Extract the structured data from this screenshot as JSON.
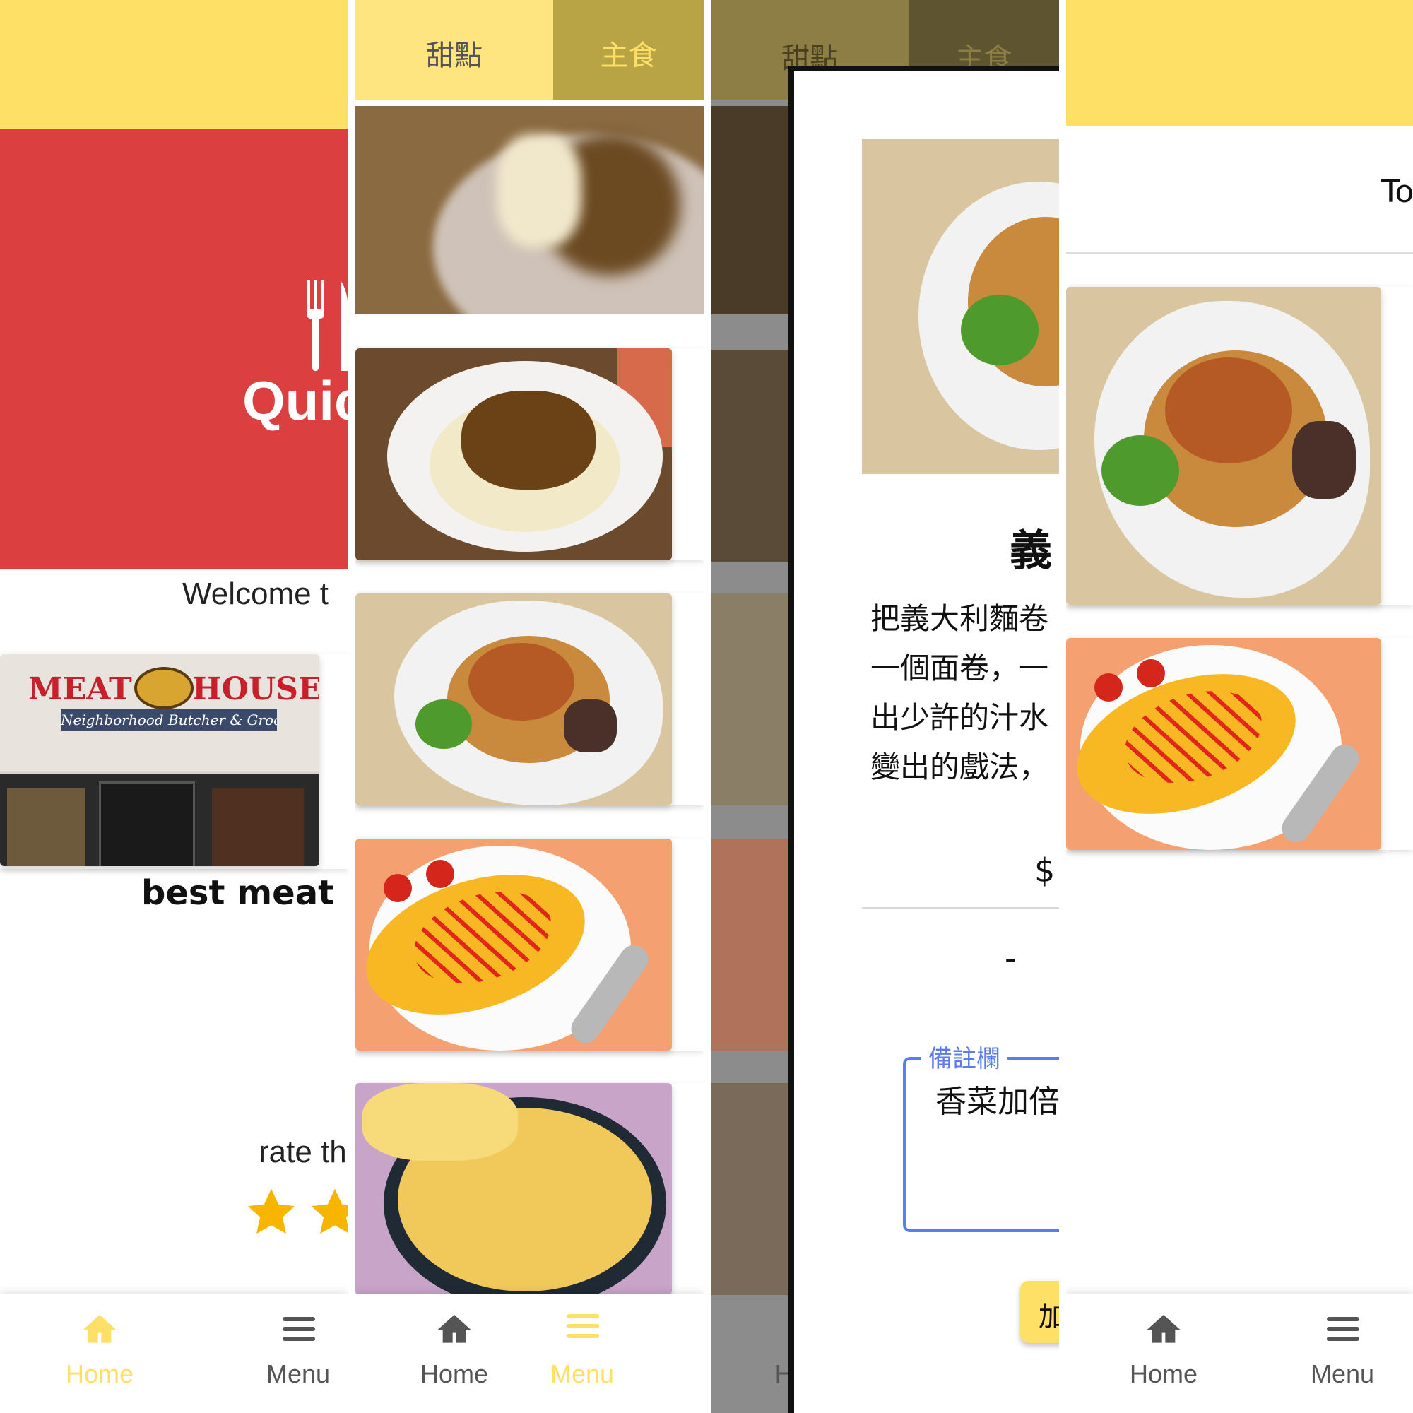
{
  "colors": {
    "yellow": "#ffe066",
    "yellow_dark": "#b8a345",
    "red": "#dc3f3f",
    "gray_text": "#666666",
    "blue": "#5b7cf0",
    "star": "#f7b500"
  },
  "panel1": {
    "banner": {
      "brand_text": "Quic",
      "icon": "fork-knife-icon"
    },
    "welcome": "Welcome t",
    "card": {
      "store_sign_1": "MEAT",
      "store_sign_2": "HOUSE",
      "store_sub": "Neighborhood Butcher & Grocer",
      "title": "best meat re"
    },
    "rate_label": "rate th",
    "rating": 2,
    "tabs": {
      "home": "Home",
      "menu": "Menu",
      "active": "home"
    }
  },
  "panel2": {
    "top_tabs": {
      "dessert": "甜點",
      "main": "主食",
      "active": "main"
    },
    "items": [
      {
        "name": "noodle-bowl-blurred",
        "icon": "noodle-image"
      },
      {
        "name": "noodle-bowl",
        "icon": "noodle-image"
      },
      {
        "name": "spaghetti",
        "icon": "spaghetti-image"
      },
      {
        "name": "omelette-rice",
        "icon": "omelette-image"
      },
      {
        "name": "pizza",
        "icon": "pizza-image"
      }
    ],
    "tabs": {
      "home": "Home",
      "menu": "Menu",
      "active": "menu"
    }
  },
  "panel3": {
    "top_tabs": {
      "dessert": "甜點",
      "main": "主食"
    },
    "dialog": {
      "title": "義",
      "description": [
        "把義大利麵卷",
        "一個面卷，一",
        "出少許的汁水",
        "變出的戲法，"
      ],
      "price": "$",
      "quantity_minus": "-",
      "note_label": "備註欄",
      "note_value": "香菜加倍",
      "add_button": "加"
    },
    "tabs": {
      "home": "H"
    }
  },
  "panel4": {
    "header_text": "To",
    "tabs": {
      "home": "Home",
      "menu": "Menu",
      "active": "none"
    }
  }
}
